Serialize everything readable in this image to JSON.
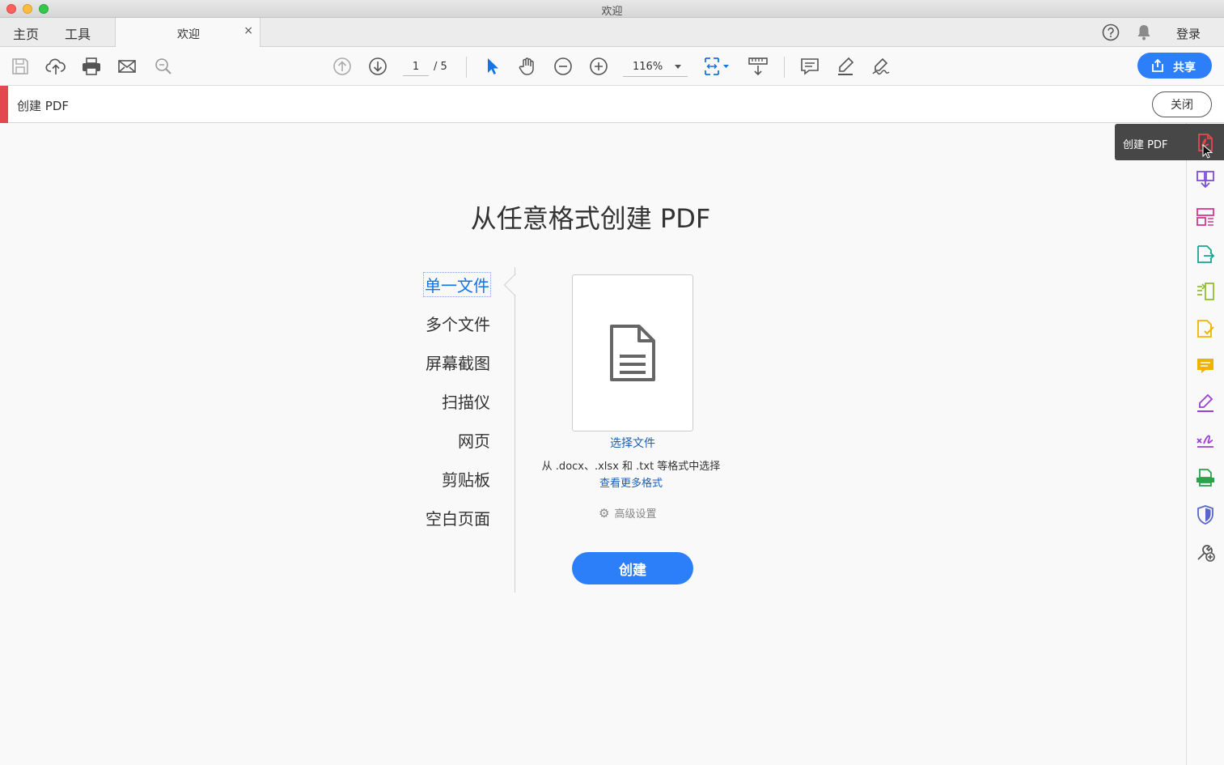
{
  "window": {
    "title": "欢迎"
  },
  "tabs": {
    "home": "主页",
    "tools": "工具",
    "document": "欢迎",
    "close_glyph": "×"
  },
  "account": {
    "login": "登录"
  },
  "toolbar": {
    "page_current": "1",
    "page_total": "/ 5",
    "zoom": "116%",
    "share_label": "共享",
    "icons": [
      "save-icon",
      "upload-icon",
      "print-icon",
      "email-icon",
      "search-icon",
      "page-up-icon",
      "page-down-icon",
      "select-cursor-icon",
      "hand-icon",
      "zoom-out-icon",
      "zoom-in-icon",
      "fit-page-icon",
      "scroll-mode-icon",
      "comment-icon",
      "highlight-icon",
      "sign-icon"
    ]
  },
  "tool_header": {
    "title": "创建 PDF",
    "close_label": "关闭"
  },
  "main": {
    "title": "从任意格式创建 PDF",
    "options": [
      "单一文件",
      "多个文件",
      "屏幕截图",
      "扫描仪",
      "网页",
      "剪贴板",
      "空白页面"
    ],
    "active_option": "单一文件",
    "select_file": "选择文件",
    "format_desc": "从 .docx、.xlsx 和 .txt 等格式中选择",
    "more_formats": "查看更多格式",
    "advanced_settings": "高级设置",
    "create_label": "创建"
  },
  "right_panel": {
    "tooltip": "创建 PDF",
    "tools": [
      {
        "name": "create-pdf-icon",
        "color": "#e34850"
      },
      {
        "name": "combine-files-icon",
        "color": "#7b4fd9"
      },
      {
        "name": "organize-pages-icon",
        "color": "#d83790"
      },
      {
        "name": "export-pdf-icon",
        "color": "#1aa38f"
      },
      {
        "name": "edit-pdf-icon",
        "color": "#8fbf2f"
      },
      {
        "name": "request-signature-icon",
        "color": "#f0b400"
      },
      {
        "name": "comment-tool-icon",
        "color": "#f0b400"
      },
      {
        "name": "fill-sign-icon",
        "color": "#9b3fd6"
      },
      {
        "name": "certificates-icon",
        "color": "#9b3fd6"
      },
      {
        "name": "scan-ocr-icon",
        "color": "#2aa34a"
      },
      {
        "name": "protect-icon",
        "color": "#5a67c9"
      },
      {
        "name": "more-tools-icon",
        "color": "#555555"
      }
    ]
  },
  "colors": {
    "accent": "#2d7ff9",
    "link": "#1a5fb4",
    "tool_accent": "#e34850"
  }
}
